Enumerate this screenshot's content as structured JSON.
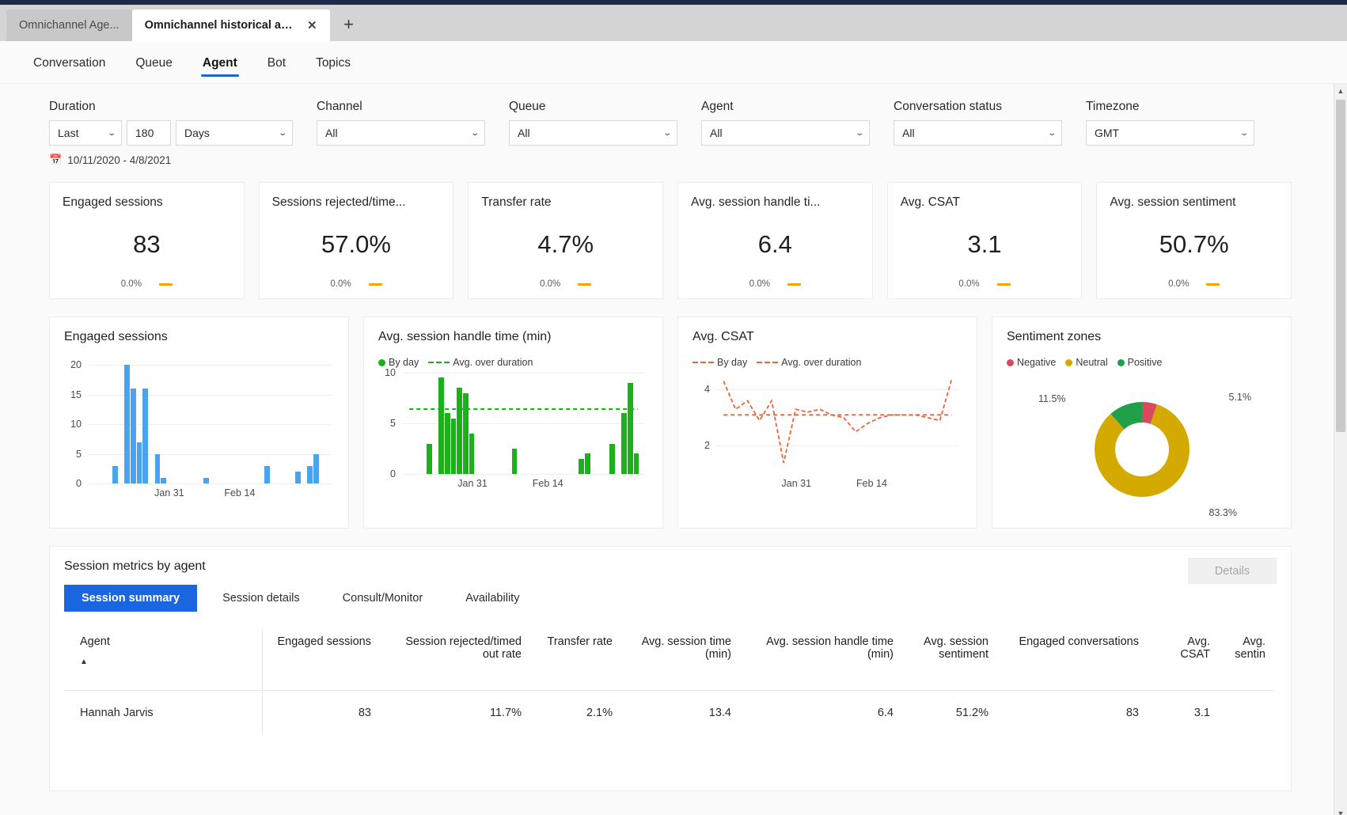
{
  "browser": {
    "tabs": [
      {
        "title": "Omnichannel Age...",
        "active": false
      },
      {
        "title": "Omnichannel historical an...",
        "active": true
      }
    ],
    "close_icon": "✕",
    "new_tab_icon": "+"
  },
  "app_nav": {
    "tabs": [
      {
        "label": "Conversation",
        "selected": false
      },
      {
        "label": "Queue",
        "selected": false
      },
      {
        "label": "Agent",
        "selected": true
      },
      {
        "label": "Bot",
        "selected": false
      },
      {
        "label": "Topics",
        "selected": false
      }
    ]
  },
  "filters": {
    "duration": {
      "label": "Duration",
      "range_value": "Last",
      "number_value": "180",
      "unit_value": "Days",
      "date_range": "10/11/2020 - 4/8/2021",
      "calendar_icon": "calendar-icon"
    },
    "channel": {
      "label": "Channel",
      "value": "All"
    },
    "queue": {
      "label": "Queue",
      "value": "All"
    },
    "agent": {
      "label": "Agent",
      "value": "All"
    },
    "conversation_status": {
      "label": "Conversation status",
      "value": "All"
    },
    "timezone": {
      "label": "Timezone",
      "value": "GMT"
    },
    "chevron": "⌄"
  },
  "kpis": [
    {
      "title": "Engaged sessions",
      "value": "83",
      "delta": "0.0%"
    },
    {
      "title": "Sessions rejected/time...",
      "value": "57.0%",
      "delta": "0.0%"
    },
    {
      "title": "Transfer rate",
      "value": "4.7%",
      "delta": "0.0%"
    },
    {
      "title": "Avg. session handle ti...",
      "value": "6.4",
      "delta": "0.0%"
    },
    {
      "title": "Avg. CSAT",
      "value": "3.1",
      "delta": "0.0%"
    },
    {
      "title": "Avg. session sentiment",
      "value": "50.7%",
      "delta": "0.0%"
    }
  ],
  "chart_data": [
    {
      "type": "bar",
      "title": "Engaged sessions",
      "xlabel": "",
      "ylabel": "",
      "ylim": [
        0,
        20
      ],
      "yticks": [
        0,
        5,
        10,
        15,
        20
      ],
      "grid": true,
      "legend": [],
      "color": "#4aa3ef",
      "xtick_labels": [
        "Jan 31",
        "Feb 14"
      ],
      "xtick_positions": [
        0.335,
        0.625
      ],
      "categories": [
        "d1",
        "d2",
        "d3",
        "d4",
        "d5",
        "d6",
        "d7",
        "d8",
        "d9",
        "d10",
        "d11",
        "d12",
        "d13",
        "d14",
        "d15",
        "d16",
        "d17",
        "d18",
        "d19",
        "d20",
        "d21",
        "d22",
        "d23",
        "d24",
        "d25",
        "d26",
        "d27",
        "d28",
        "d29",
        "d30",
        "d31",
        "d32",
        "d33",
        "d34",
        "d35",
        "d36",
        "d37",
        "d38",
        "d39",
        "d40"
      ],
      "values": [
        0,
        0,
        0,
        0,
        3,
        0,
        20,
        16,
        7,
        16,
        0,
        5,
        1,
        0,
        0,
        0,
        0,
        0,
        0,
        1,
        0,
        0,
        0,
        0,
        0,
        0,
        0,
        0,
        0,
        3,
        0,
        0,
        0,
        0,
        2,
        0,
        3,
        5,
        0,
        0
      ]
    },
    {
      "type": "bar",
      "title": "Avg. session handle time (min)",
      "xlabel": "",
      "ylabel": "",
      "ylim": [
        0,
        10
      ],
      "yticks": [
        0,
        5,
        10
      ],
      "grid": true,
      "legend": [
        {
          "name": "By day",
          "marker": "dot",
          "color": "#19b219"
        },
        {
          "name": "Avg. over duration",
          "marker": "dash",
          "color": "#19b219"
        }
      ],
      "legend_position": "top-left",
      "color": "#19b219",
      "average_line": 6.4,
      "xtick_labels": [
        "Jan 31",
        "Feb 14"
      ],
      "xtick_positions": [
        0.29,
        0.6
      ],
      "categories": [
        "d1",
        "d2",
        "d3",
        "d4",
        "d5",
        "d6",
        "d7",
        "d8",
        "d9",
        "d10",
        "d11",
        "d12",
        "d13",
        "d14",
        "d15",
        "d16",
        "d17",
        "d18",
        "d19",
        "d20",
        "d21",
        "d22",
        "d23",
        "d24",
        "d25",
        "d26",
        "d27",
        "d28",
        "d29",
        "d30",
        "d31",
        "d32",
        "d33",
        "d34",
        "d35",
        "d36",
        "d37",
        "d38",
        "d39",
        "d40"
      ],
      "values": [
        0,
        0,
        0,
        0,
        3,
        0,
        9.5,
        6,
        5.5,
        8.5,
        8,
        4,
        0,
        0,
        0,
        0,
        0,
        0,
        2.5,
        0,
        0,
        0,
        0,
        0,
        0,
        0,
        0,
        0,
        0,
        1.5,
        2,
        0,
        0,
        0,
        3,
        0,
        6,
        9,
        2,
        0
      ]
    },
    {
      "type": "line",
      "title": "Avg. CSAT",
      "xlabel": "",
      "ylabel": "",
      "ylim": [
        1,
        4.6
      ],
      "yticks": [
        2,
        4
      ],
      "grid": true,
      "legend": [
        {
          "name": "By day",
          "marker": "dash",
          "color": "#e8663c"
        },
        {
          "name": "Avg. over duration",
          "marker": "dash",
          "color": "#e8663c"
        }
      ],
      "legend_position": "top-left",
      "color": "#e8663c",
      "average_line": 3.1,
      "xtick_labels": [
        "Jan 31",
        "Feb 14"
      ],
      "xtick_positions": [
        0.33,
        0.64
      ],
      "x": [
        0,
        1,
        2,
        3,
        4,
        5,
        6,
        7,
        8,
        9,
        10,
        11,
        12,
        13,
        14,
        15,
        16,
        17,
        18,
        19
      ],
      "values": [
        4.3,
        3.3,
        3.6,
        2.9,
        3.6,
        1.4,
        3.3,
        3.2,
        3.3,
        3.1,
        3.0,
        2.5,
        2.8,
        3.0,
        3.1,
        3.1,
        3.1,
        3.0,
        2.9,
        4.4
      ]
    },
    {
      "type": "pie",
      "title": "Sentiment zones",
      "donut": true,
      "legend_position": "top-left",
      "labels": [
        "Negative",
        "Neutral",
        "Positive"
      ],
      "values": [
        5.1,
        83.3,
        11.5
      ],
      "value_labels": [
        "5.1%",
        "83.3%",
        "11.5%"
      ],
      "colors": [
        "#d94a5c",
        "#d4aa00",
        "#21a049"
      ]
    }
  ],
  "session_metrics": {
    "title": "Session metrics by agent",
    "details_button": "Details",
    "pills": [
      {
        "label": "Session summary",
        "active": true
      },
      {
        "label": "Session details",
        "active": false
      },
      {
        "label": "Consult/Monitor",
        "active": false
      },
      {
        "label": "Availability",
        "active": false
      }
    ],
    "sort_caret": "▲",
    "columns": [
      "Agent",
      "Engaged sessions",
      "Session rejected/timed out rate",
      "Transfer rate",
      "Avg. session time (min)",
      "Avg. session handle time (min)",
      "Avg. session sentiment",
      "Engaged conversations",
      "Avg. CSAT",
      "Avg. sentin"
    ],
    "rows": [
      {
        "agent": "Hannah Jarvis",
        "engaged_sessions": "83",
        "session_rejected_rate": "11.7%",
        "transfer_rate": "2.1%",
        "avg_session_time": "13.4",
        "avg_session_handle_time": "6.4",
        "avg_session_sentiment": "51.2%",
        "engaged_conversations": "83",
        "avg_csat": "3.1",
        "avg_sentiment": ""
      }
    ]
  },
  "scrollbar": {
    "up_icon": "▲",
    "down_icon": "▼"
  }
}
